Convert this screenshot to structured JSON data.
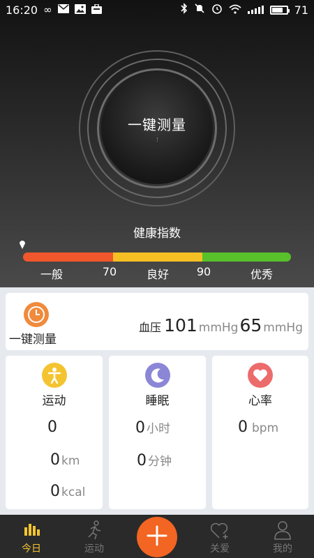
{
  "status_bar": {
    "time": "16:20",
    "battery": "71",
    "icons": [
      "infinity-icon",
      "mail-icon",
      "image-icon",
      "briefcase-icon",
      "bluetooth-icon",
      "mute-icon",
      "alarm-icon",
      "wifi-icon",
      "signal-icon",
      "battery-icon"
    ]
  },
  "measure_button": {
    "label": "一键测量"
  },
  "health_index": {
    "title": "健康指数",
    "segments": [
      {
        "label": "一般",
        "color": "#f1572c"
      },
      {
        "label": "良好",
        "color": "#f6c025"
      },
      {
        "label": "优秀",
        "color": "#58c02a"
      }
    ],
    "thresholds": [
      "70",
      "90"
    ],
    "indicator_value": 0
  },
  "measure_card": {
    "label": "一键测量",
    "bp_label": "血压",
    "systolic": "101",
    "diastolic": "65",
    "unit": "mmHg",
    "icon": "clock-icon",
    "icon_color": "#f08a3c"
  },
  "stats": {
    "sport": {
      "title": "运动",
      "icon": "person-icon",
      "icon_color": "#f4c430",
      "steps": "0",
      "distance": "0",
      "distance_unit": "km",
      "calories": "0",
      "calories_unit": "kcal"
    },
    "sleep": {
      "title": "睡眠",
      "icon": "moon-icon",
      "icon_color": "#8b86d6",
      "hours": "0",
      "hours_unit": "小时",
      "minutes": "0",
      "minutes_unit": "分钟"
    },
    "heart": {
      "title": "心率",
      "icon": "heart-icon",
      "icon_color": "#ec6b6b",
      "bpm": "0",
      "bpm_unit": "bpm"
    }
  },
  "nav": {
    "items": [
      {
        "label": "今日",
        "icon": "bar-chart-icon",
        "active": true
      },
      {
        "label": "运动",
        "icon": "runner-icon",
        "active": false
      },
      {
        "label": "关爱",
        "icon": "heart-plus-icon",
        "active": false
      },
      {
        "label": "我的",
        "icon": "user-icon",
        "active": false
      }
    ],
    "plus_icon": "plus-icon",
    "active_color": "#f4c430",
    "plus_color": "#f26522"
  }
}
